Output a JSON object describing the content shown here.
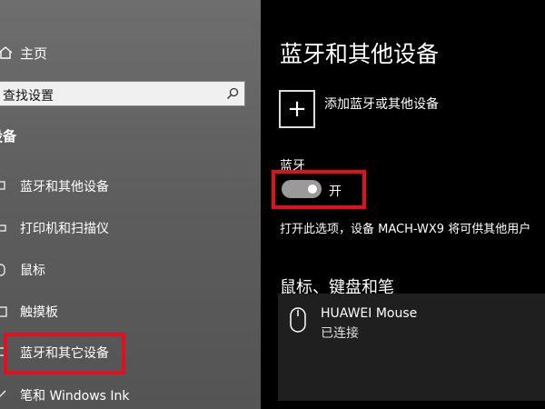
{
  "sidebar": {
    "home_label": "主页",
    "search_text": "查找设置",
    "section_title": "设备",
    "items": [
      {
        "label": "蓝牙和其他设备",
        "icon": "bluetooth-devices-icon"
      },
      {
        "label": "打印机和扫描仪",
        "icon": "printer-icon"
      },
      {
        "label": "鼠标",
        "icon": "mouse-icon"
      },
      {
        "label": "触摸板",
        "icon": "touchpad-icon"
      },
      {
        "label": "蓝牙和其它设备",
        "icon": "bluetooth-devices-icon"
      },
      {
        "label": "笔和 Windows Ink",
        "icon": "pen-icon"
      }
    ]
  },
  "main": {
    "title": "蓝牙和其他设备",
    "add_device_label": "添加蓝牙或其他设备",
    "add_icon": "+",
    "bluetooth_label": "蓝牙",
    "toggle_state": "开",
    "description": "打开此选项，设备 MACH-WX9 将可供其他用户",
    "devices_header": "鼠标、键盘和笔",
    "device": {
      "name": "HUAWEI  Mouse",
      "status": "已连接",
      "icon": "mouse-icon"
    }
  },
  "colors": {
    "highlight": "#e0101e",
    "sidebar_bg": "#5d5d5d",
    "main_bg": "#000000",
    "device_row_bg": "#1f1f1f"
  }
}
